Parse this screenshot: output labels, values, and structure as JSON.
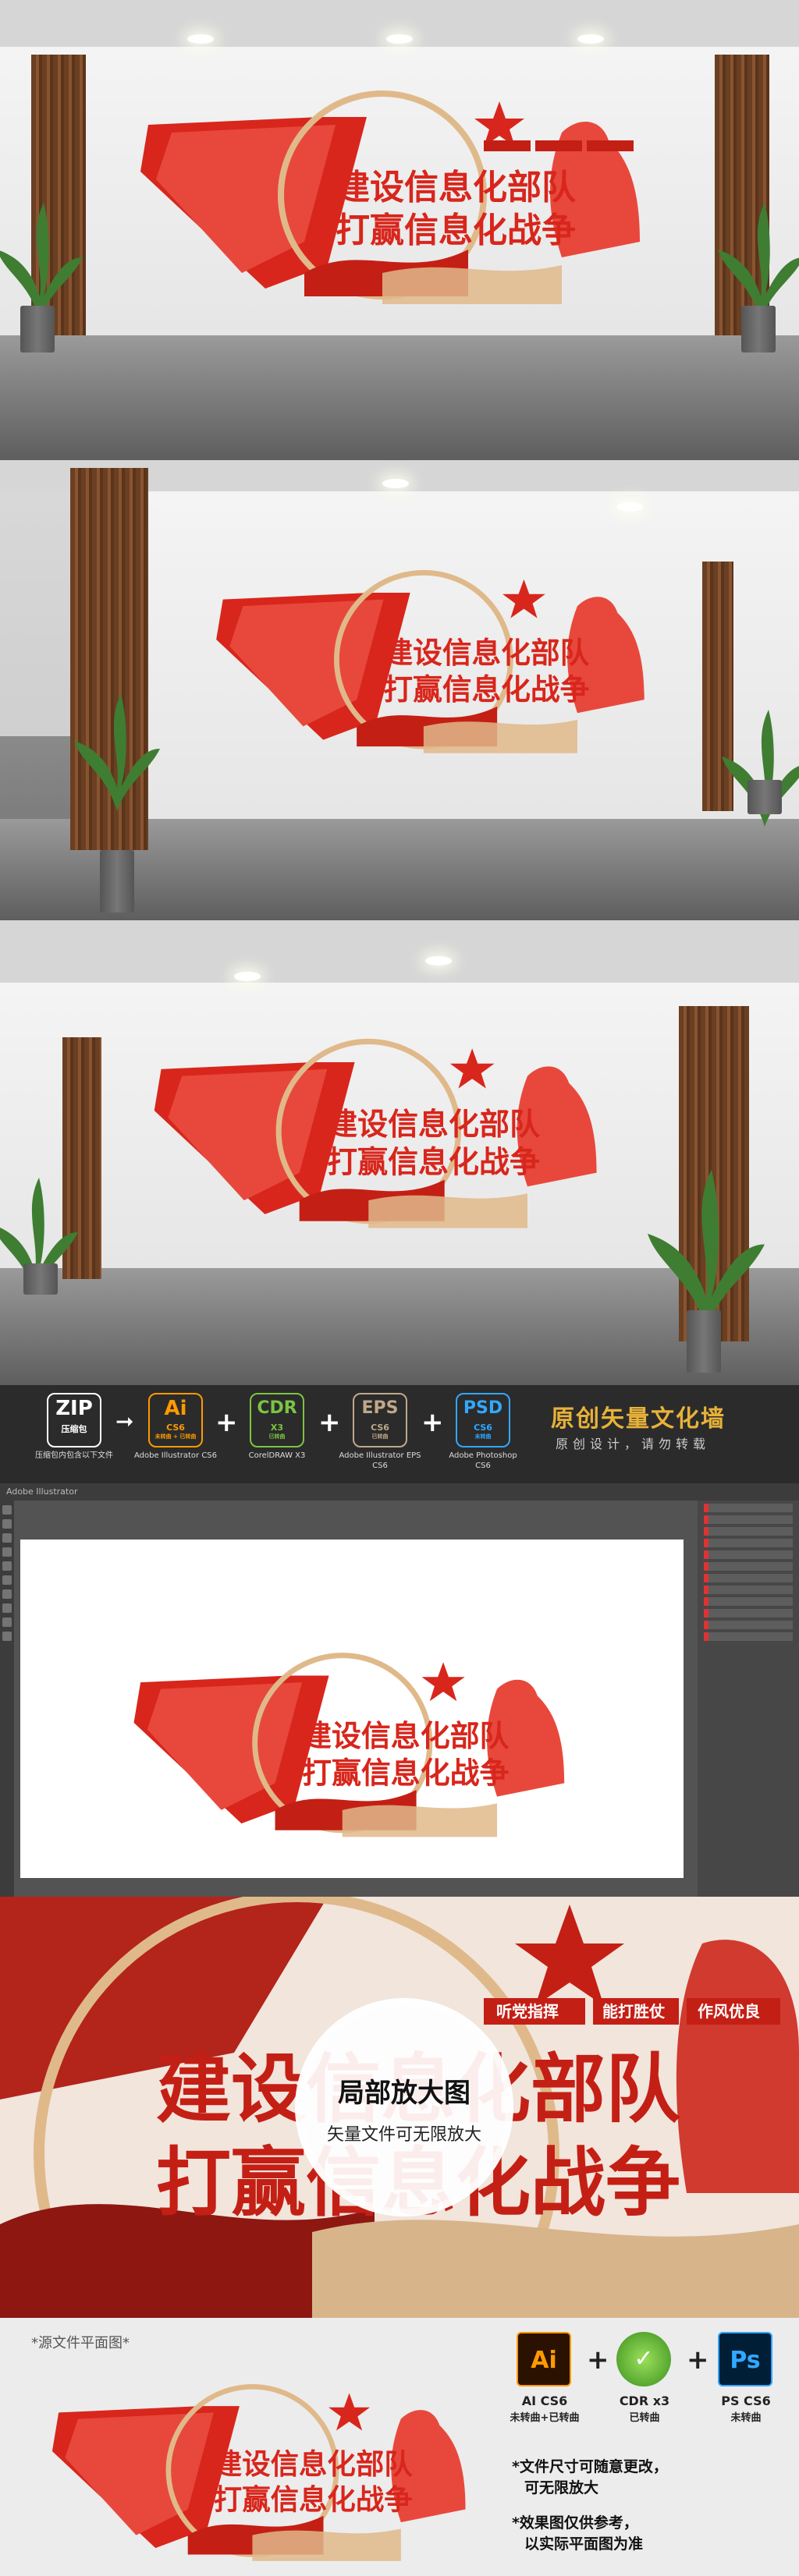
{
  "sign": {
    "title_line1": "建设信息化部队",
    "title_line2": "打赢信息化战争",
    "tags": [
      "听党指挥",
      "能打胜仗",
      "作风优良"
    ]
  },
  "formats": {
    "zip": {
      "label": "ZIP",
      "sub": "压缩包",
      "caption": "压缩包内包含以下文件"
    },
    "ai": {
      "label": "Ai",
      "sub": "CS6",
      "sub2": "未转曲 + 已转曲",
      "caption": "Adobe Illustrator CS6"
    },
    "cdr": {
      "label": "CDR",
      "sub": "X3",
      "sub2": "已转曲",
      "caption": "CorelDRAW X3"
    },
    "eps": {
      "label": "EPS",
      "sub": "CS6",
      "sub2": "已转曲",
      "caption": "Adobe Illustrator EPS CS6"
    },
    "psd": {
      "label": "PSD",
      "sub": "CS6",
      "sub2": "未转曲",
      "caption": "Adobe Photoshop CS6"
    },
    "brand_title": "原创矢量文化墙",
    "brand_sub": "原创设计，请勿转载"
  },
  "illustrator": {
    "window_title": "Adobe Illustrator"
  },
  "zoom": {
    "circle_title": "局部放大图",
    "circle_sub": "矢量文件可无限放大"
  },
  "footer": {
    "source_label": "*源文件平面图*",
    "software": [
      {
        "icon": "Ai",
        "caption1": "AI CS6",
        "caption2": "未转曲+已转曲"
      },
      {
        "icon": "",
        "caption1": "CDR x3",
        "caption2": "已转曲"
      },
      {
        "icon": "Ps",
        "caption1": "PS CS6",
        "caption2": "未转曲"
      }
    ],
    "note1_a": "*文件尺寸可随意更改，",
    "note1_b": "可无限放大",
    "note2_a": "*效果图仅供参考，",
    "note2_b": "以实际平面图为准"
  },
  "colors": {
    "brand_red": "#d8261c",
    "gold": "#e0b98a",
    "ai_orange": "#ff9a00",
    "ps_blue": "#31a8ff"
  }
}
